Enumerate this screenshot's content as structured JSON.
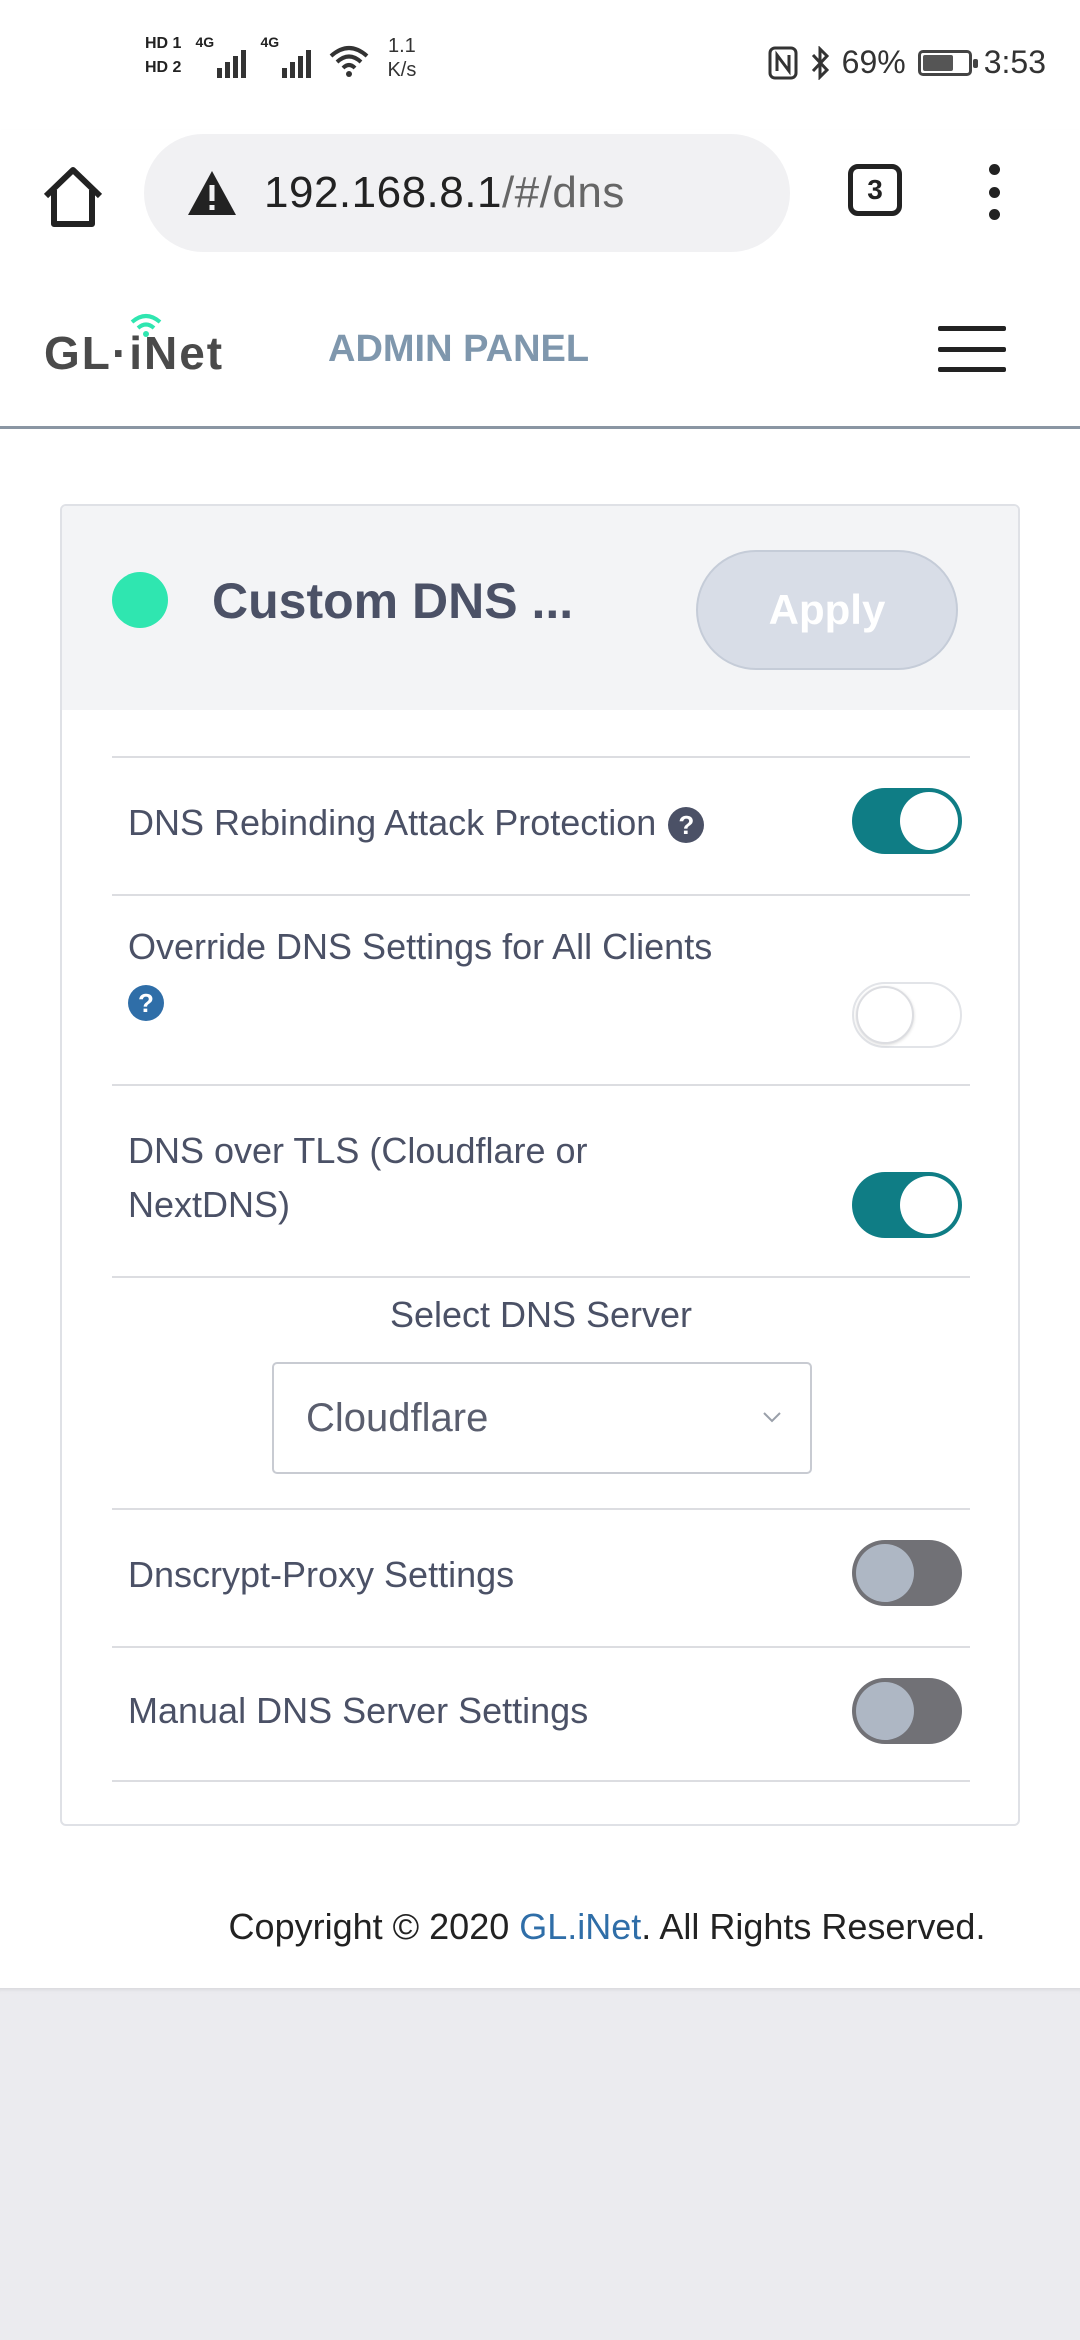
{
  "status_bar": {
    "hd_1": "HD 1",
    "hd_2": "HD 2",
    "network_1": "4G",
    "network_2": "4G",
    "net_speed_value": "1.1",
    "net_speed_unit": "K/s",
    "battery_percent": "69%",
    "battery_level": 0.69,
    "time": "3:53"
  },
  "browser": {
    "url_host": "192.168.8.1",
    "url_path": "/#/dns",
    "tab_count": "3"
  },
  "header": {
    "logo_text": "GL·iNet",
    "title": "ADMIN PANEL"
  },
  "card": {
    "status_color": "#2fe6b0",
    "title": "Custom DNS ...",
    "apply_label": "Apply",
    "settings": [
      {
        "label": "DNS Rebinding Attack Protection",
        "state": "on"
      },
      {
        "label": "Override DNS Settings for All Clients",
        "state": "off"
      },
      {
        "label": "DNS over TLS (Cloudflare or NextDNS)",
        "state": "on"
      },
      {
        "label": "Dnscrypt-Proxy Settings",
        "state": "off"
      },
      {
        "label": "Manual DNS Server Settings",
        "state": "off"
      }
    ],
    "select": {
      "label": "Select DNS Server",
      "value": "Cloudflare"
    },
    "help_symbol": "?"
  },
  "footer": {
    "prefix": "Copyright © 2020 ",
    "brand": "GL.iNet",
    "suffix": ". All Rights Reserved."
  },
  "colors": {
    "toggle_on": "#0f7d85",
    "accent_blue": "#2f6ea8",
    "admin_title": "#7f97ad"
  }
}
